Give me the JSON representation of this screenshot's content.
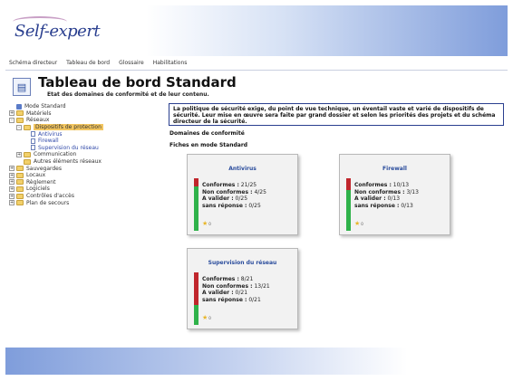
{
  "brand": {
    "logo_text": "Self-expert"
  },
  "nav": [
    "Schéma directeur",
    "Tableau de bord",
    "Glossaire",
    "Habilitations"
  ],
  "page": {
    "title": "Tableau de bord Standard",
    "subtitle": "Etat des domaines de conformité et de leur contenu."
  },
  "tree": [
    {
      "label": "Mode Standard",
      "indent": 0,
      "toggle": "",
      "icon": "mode"
    },
    {
      "label": "Matériels",
      "indent": 0,
      "toggle": "+",
      "icon": "folder"
    },
    {
      "label": "Réseaux",
      "indent": 0,
      "toggle": "-",
      "icon": "folder"
    },
    {
      "label": "Dispositifs de protection",
      "indent": 1,
      "toggle": "-",
      "icon": "folder",
      "selected": true
    },
    {
      "label": "Antivirus",
      "indent": 2,
      "toggle": "",
      "icon": "doc",
      "link": true
    },
    {
      "label": "Firewall",
      "indent": 2,
      "toggle": "",
      "icon": "doc",
      "link": true
    },
    {
      "label": "Supervision du réseau",
      "indent": 2,
      "toggle": "",
      "icon": "doc",
      "link": true
    },
    {
      "label": "Communication",
      "indent": 1,
      "toggle": "+",
      "icon": "folder"
    },
    {
      "label": "Autres éléments réseaux",
      "indent": 1,
      "toggle": "",
      "icon": "folder"
    },
    {
      "label": "Sauvegardes",
      "indent": 0,
      "toggle": "+",
      "icon": "folder"
    },
    {
      "label": "Locaux",
      "indent": 0,
      "toggle": "+",
      "icon": "folder"
    },
    {
      "label": "Règlement",
      "indent": 0,
      "toggle": "+",
      "icon": "folder"
    },
    {
      "label": "Logiciels",
      "indent": 0,
      "toggle": "+",
      "icon": "folder"
    },
    {
      "label": "Contrôles d'accès",
      "indent": 0,
      "toggle": "+",
      "icon": "folder"
    },
    {
      "label": "Plan de secours",
      "indent": 0,
      "toggle": "+",
      "icon": "folder"
    }
  ],
  "description": "La politique de sécurité exige, du point de vue technique, un éventail vaste et varié de dispositifs de sécurité. Leur mise en œuvre sera faite par grand dossier et selon les priorités des projets et du schéma directeur de la sécurité.",
  "labels": {
    "domain": "Domaines de conformité",
    "mode": "Fiches en mode Standard"
  },
  "cards": [
    {
      "title": "Antivirus",
      "conformes_label": "Conformes :",
      "conformes": "21/25",
      "non_conformes_label": "Non conformes :",
      "non_conformes": "4/25",
      "a_valider_label": "A valider :",
      "a_valider": "0/25",
      "sans_reponse_label": "sans réponse :",
      "sans_reponse": "0/25",
      "red_fraction": 0.16,
      "star_count": "0"
    },
    {
      "title": "Firewall",
      "conformes_label": "Conformes :",
      "conformes": "10/13",
      "non_conformes_label": "Non conformes :",
      "non_conformes": "3/13",
      "a_valider_label": "A valider :",
      "a_valider": "0/13",
      "sans_reponse_label": "sans réponse :",
      "sans_reponse": "0/13",
      "red_fraction": 0.23,
      "star_count": "0"
    },
    {
      "title": "Supervision du réseau",
      "conformes_label": "Conformes :",
      "conformes": "8/21",
      "non_conformes_label": "Non conformes :",
      "non_conformes": "13/21",
      "a_valider_label": "A valider :",
      "a_valider": "0/21",
      "sans_reponse_label": "sans réponse :",
      "sans_reponse": "0/21",
      "red_fraction": 0.62,
      "star_count": "0"
    }
  ],
  "colors": {
    "accent": "#2a4c9c",
    "red": "#c0262c",
    "green": "#2fb24a",
    "selected": "#f3c660"
  }
}
